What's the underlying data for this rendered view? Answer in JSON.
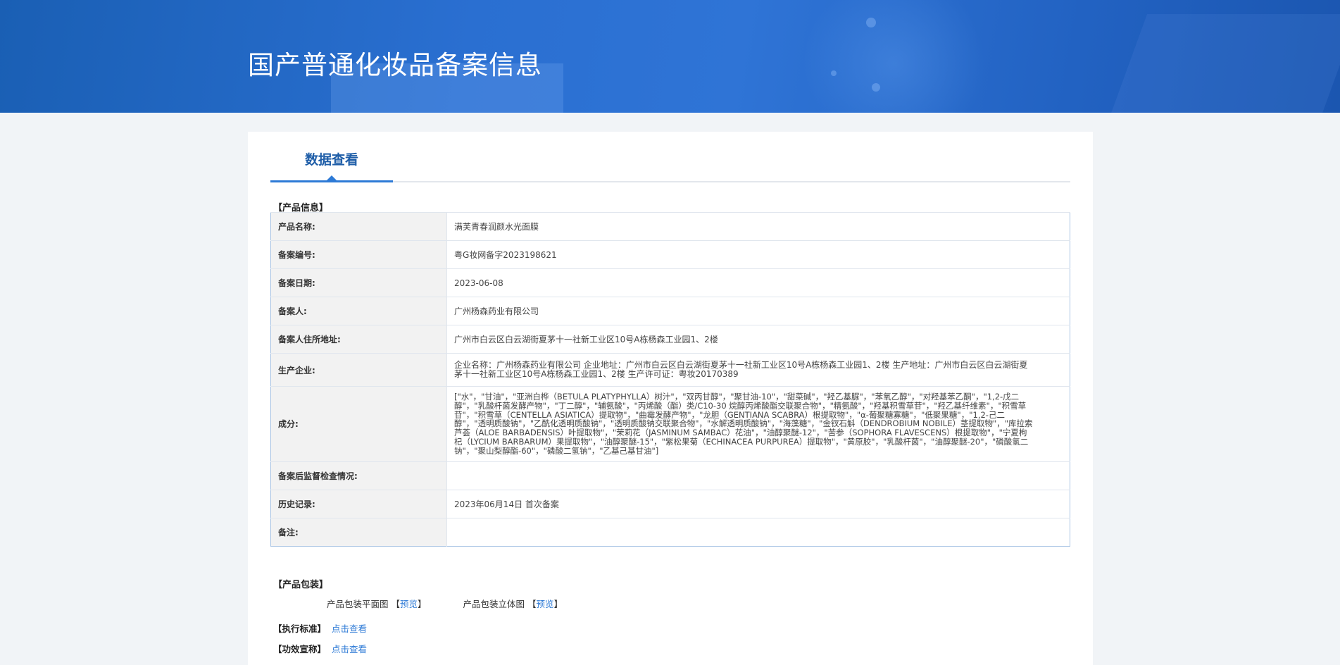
{
  "header": {
    "title": "国产普通化妆品备案信息"
  },
  "tabs": [
    {
      "label": "数据查看",
      "active": true
    }
  ],
  "product_info": {
    "section_title": "【产品信息】",
    "rows": [
      {
        "label": "产品名称:",
        "value": "满芙青春润颜水光面膜"
      },
      {
        "label": "备案编号:",
        "value": "粤G妆网备字2023198621"
      },
      {
        "label": "备案日期:",
        "value": "2023-06-08"
      },
      {
        "label": "备案人:",
        "value": "广州杨森药业有限公司"
      },
      {
        "label": "备案人住所地址:",
        "value": "广州市白云区白云湖街夏茅十一社新工业区10号A栋杨森工业园1、2楼"
      },
      {
        "label": "生产企业:",
        "value": "企业名称：广州杨森药业有限公司 企业地址：广州市白云区白云湖街夏茅十一社新工业区10号A栋杨森工业园1、2楼 生产地址：广州市白云区白云湖街夏茅十一社新工业区10号A栋杨森工业园1、2楼 生产许可证：粤妆20170389"
      },
      {
        "label": "成分:",
        "value": "[\"水\"，\"甘油\"，\"亚洲白桦（BETULA PLATYPHYLLA）树汁\"，\"双丙甘醇\"，\"聚甘油-10\"，\"甜菜碱\"，\"羟乙基脲\"，\"苯氧乙醇\"，\"对羟基苯乙酮\"，\"1,2-戊二醇\"，\"乳酸杆菌发酵产物\"，\"丁二醇\"，\"辅氨酸\"，\"丙烯酸（酯）类/C10-30 烷醇丙烯酸酯交联聚合物\"，\"精氨酸\"，\"羟基积雪草苷\"，\"羟乙基纤维素\"，\"积雪草苷\"，\"积雪草（CENTELLA ASIATICA）提取物\"，\"曲霉发酵产物\"，\"龙胆（GENTIANA SCABRA）根提取物\"，\"α-葡聚糖寡糖\"，\"低聚果糖\"，\"1,2-己二醇\"，\"透明质酸钠\"，\"乙酰化透明质酸钠\"，\"透明质酸钠交联聚合物\"，\"水解透明质酸钠\"，\"海藻糖\"，\"金钗石斛（DENDROBIUM NOBILE）茎提取物\"，\"库拉索芦荟（ALOE BARBADENSIS）叶提取物\"，\"茉莉花（JASMINUM SAMBAC）花油\"，\"油醇聚醚-12\"，\"苦参（SOPHORA FLAVESCENS）根提取物\"，\"宁夏枸杞（LYCIUM BARBARUM）果提取物\"，\"油醇聚醚-15\"，\"紫松果菊（ECHINACEA PURPUREA）提取物\"，\"黄原胶\"，\"乳酸杆菌\"，\"油醇聚醚-20\"，\"磷酸氢二钠\"，\"聚山梨醇酯-60\"，\"磷酸二氢钠\"，\"乙基己基甘油\"]"
      },
      {
        "label": "备案后监督检查情况:",
        "value": ""
      },
      {
        "label": "历史记录:",
        "value": "2023年06月14日 首次备案"
      },
      {
        "label": "备注:",
        "value": ""
      }
    ]
  },
  "packaging": {
    "section_title": "【产品包装】",
    "flat_label": "产品包装平面图",
    "solid_label": "产品包装立体图",
    "bracket_open": "【",
    "bracket_close": "】",
    "preview_link": "预览"
  },
  "standard": {
    "label": "【执行标准】",
    "link": "点击查看"
  },
  "efficacy": {
    "label": "【功效宣称】",
    "link": "点击查看"
  },
  "colors": {
    "banner": "#2a6fd1",
    "link": "#2d7ad6",
    "tab_active": "#1f5ea8",
    "table_border": "#a9c4e4"
  }
}
